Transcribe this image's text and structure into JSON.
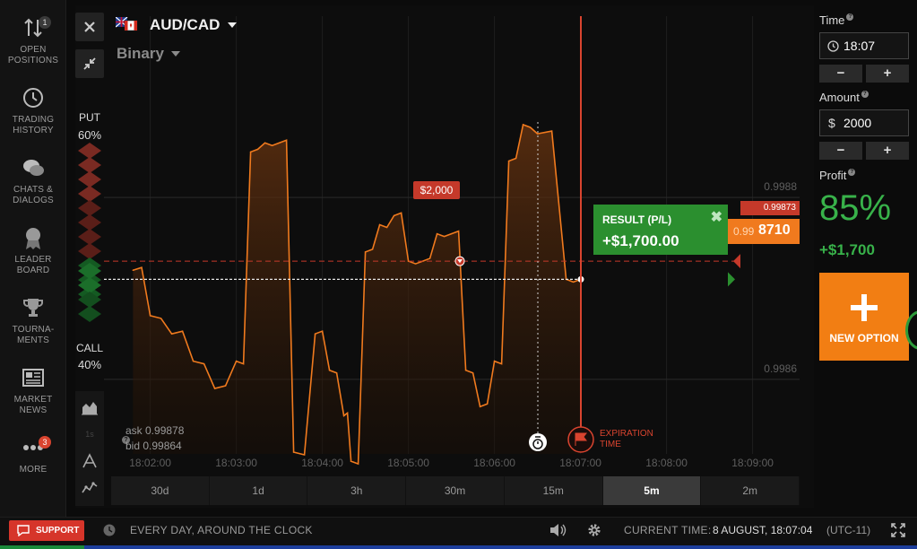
{
  "sidebar": {
    "items": [
      {
        "icon": "arrows-updown-icon",
        "label": "OPEN\nPOSITIONS",
        "badge": "1"
      },
      {
        "icon": "history-clock-icon",
        "label": "TRADING\nHISTORY"
      },
      {
        "icon": "chat-bubbles-icon",
        "label": "CHATS &\nDIALOGS"
      },
      {
        "icon": "ribbon-medal-icon",
        "label": "LEADER\nBOARD"
      },
      {
        "icon": "trophy-icon",
        "label": "TOURNA-\nMENTS"
      },
      {
        "icon": "newspaper-icon",
        "label": "MARKET\nNEWS"
      },
      {
        "icon": "dots-more-icon",
        "label": "MORE",
        "badge": "3"
      }
    ]
  },
  "chart": {
    "asset": "AUD/CAD",
    "mode": "Binary",
    "put_label": "PUT",
    "put_pct": "60%",
    "call_label": "CALL",
    "call_pct": "40%",
    "ask": "ask 0.99878",
    "bid": "bid 0.99864",
    "investment_badge": "$2,000",
    "open_price_tag": "0.99873",
    "current_price_prefix": "0.99",
    "current_price_suffix": "8710",
    "result_title": "RESULT (P/L)",
    "result_value": "+$1,700.00",
    "expiration_label_1": "EXPIRATION",
    "expiration_label_2": "TIME",
    "price_gridlines": [
      "0.9988",
      "0.9986"
    ],
    "time_ticks": [
      "18:02:00",
      "18:03:00",
      "18:04:00",
      "18:05:00",
      "18:06:00",
      "18:07:00",
      "18:08:00",
      "18:09:00"
    ],
    "colors": {
      "line": "#f07a1e",
      "put": "#c5392a",
      "call": "#2b8f2f",
      "expiry": "#d9442f"
    }
  },
  "chart_data": {
    "type": "area",
    "title": "",
    "xlabel": "",
    "ylabel": "",
    "x": [
      "18:01:48",
      "18:02:00",
      "18:02:15",
      "18:02:30",
      "18:02:45",
      "18:03:00",
      "18:03:10",
      "18:03:20",
      "18:03:30",
      "18:03:40",
      "18:03:55",
      "18:04:05",
      "18:04:15",
      "18:04:20",
      "18:04:30",
      "18:04:40",
      "18:04:50",
      "18:05:00",
      "18:05:10",
      "18:05:20",
      "18:05:30",
      "18:05:40",
      "18:05:50",
      "18:06:00",
      "18:06:10",
      "18:06:20",
      "18:06:30",
      "18:06:50",
      "18:07:00"
    ],
    "y": [
      0.99872,
      0.99867,
      0.99865,
      0.99862,
      0.99859,
      0.99862,
      0.99885,
      0.99886,
      0.99886,
      0.99852,
      0.99865,
      0.99861,
      0.99856,
      0.99851,
      0.99874,
      0.99877,
      0.99878,
      0.99873,
      0.99873,
      0.99876,
      0.99876,
      0.99861,
      0.99857,
      0.99862,
      0.99884,
      0.99888,
      0.99887,
      0.99871,
      0.99871
    ],
    "ylim": [
      0.99852,
      0.99895
    ],
    "y_ticks": [
      0.9988,
      0.9986
    ]
  },
  "timeframes": [
    "30d",
    "1d",
    "3h",
    "30m",
    "15m",
    "5m",
    "2m"
  ],
  "timeframe_active": "5m",
  "right_panel": {
    "time_label": "Time",
    "time_value": "18:07",
    "amount_label": "Amount",
    "amount_prefix": "$",
    "amount_value": "2000",
    "minus": "−",
    "plus": "+",
    "profit_label": "Profit",
    "profit_pct": "85%",
    "profit_amount": "+$1,700",
    "new_option": "NEW OPTION"
  },
  "bottom_bar": {
    "support": "SUPPORT",
    "hours": "EVERY DAY, AROUND THE CLOCK",
    "current_time_label": "CURRENT TIME:",
    "current_time_value": "8 AUGUST, 18:07:04",
    "timezone": "(UTC-11)"
  }
}
